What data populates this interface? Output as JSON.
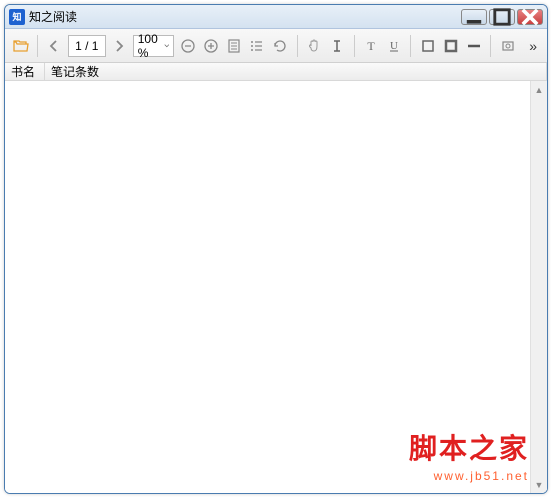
{
  "window": {
    "title": "知之阅读",
    "app_icon_text": "知"
  },
  "toolbar": {
    "page_display": "1 / 1",
    "zoom_display": "100 %",
    "more": "»"
  },
  "list": {
    "columns": {
      "c1": "书名",
      "c2": "笔记条数"
    }
  },
  "watermark": {
    "main": "脚本之家",
    "url": "www.jb51.net"
  }
}
